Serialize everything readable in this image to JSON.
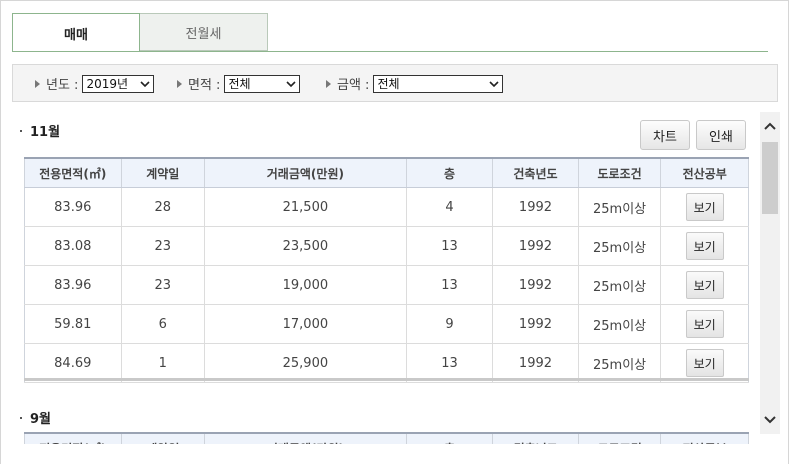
{
  "tabs": [
    {
      "label": "매매",
      "active": true
    },
    {
      "label": "전월세",
      "active": false
    }
  ],
  "filters": {
    "year": {
      "label": "년도 :",
      "value": "2019년"
    },
    "area": {
      "label": "면적 :",
      "value": "전체"
    },
    "amount": {
      "label": "금액 :",
      "value": "전체"
    }
  },
  "buttons": {
    "chart": "차트",
    "print": "인쇄"
  },
  "table_headers": [
    "전용면적(㎡)",
    "계약일",
    "거래금액(만원)",
    "층",
    "건축년도",
    "도로조건",
    "전산공부"
  ],
  "sections": [
    {
      "month": "11월",
      "rows": [
        {
          "area": "83.96",
          "day": "28",
          "price": "21,500",
          "floor": "4",
          "year": "1992",
          "road": "25m이상",
          "action": "보기"
        },
        {
          "area": "83.08",
          "day": "23",
          "price": "23,500",
          "floor": "13",
          "year": "1992",
          "road": "25m이상",
          "action": "보기"
        },
        {
          "area": "83.96",
          "day": "23",
          "price": "19,000",
          "floor": "13",
          "year": "1992",
          "road": "25m이상",
          "action": "보기"
        },
        {
          "area": "59.81",
          "day": "6",
          "price": "17,000",
          "floor": "9",
          "year": "1992",
          "road": "25m이상",
          "action": "보기"
        },
        {
          "area": "84.69",
          "day": "1",
          "price": "25,900",
          "floor": "13",
          "year": "1992",
          "road": "25m이상",
          "action": "보기"
        }
      ]
    },
    {
      "month": "9월",
      "rows": []
    }
  ],
  "colors": {
    "tab_border": "#8db58d",
    "header_bg": "#eef3fb",
    "filter_bg": "#f4f4f4"
  }
}
